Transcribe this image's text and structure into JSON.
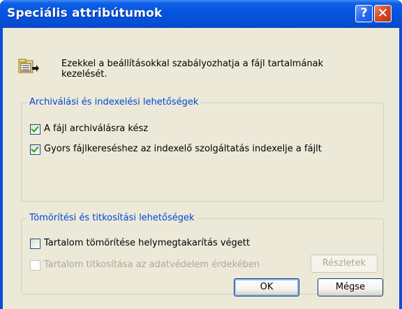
{
  "window": {
    "title": "Speciális attribútumok",
    "help_glyph": "?",
    "close_glyph": "✕"
  },
  "intro": {
    "icon": "attributes-dialog-icon",
    "line1": "Ezekkel a beállításokkal szabályozhatja a fájl tartalmának",
    "line2": "kezelését."
  },
  "archive_group": {
    "legend": "Archiválási és indexelési lehetőségek",
    "items": [
      {
        "label": "A fájl archiválásra kész",
        "checked": true
      },
      {
        "label": "Gyors fájlkereséshez az indexelő szolgáltatás indexelje a fájlt",
        "checked": true
      }
    ]
  },
  "compress_group": {
    "legend": "Tömörítési és titkosítási lehetőségek",
    "compress": {
      "label": "Tartalom tömörítése helymegtakarítás végett",
      "checked": false
    },
    "encrypt": {
      "label": "Tartalom titkosítása az adatvédelem érdekében",
      "checked": false,
      "enabled": false
    },
    "details_button": "Részletek"
  },
  "buttons": {
    "ok": "OK",
    "cancel": "Mégse"
  },
  "colors": {
    "title_bar": "#0553e0",
    "client": "#ece9d8",
    "legend": "#0046d5",
    "check": "#21a121"
  }
}
